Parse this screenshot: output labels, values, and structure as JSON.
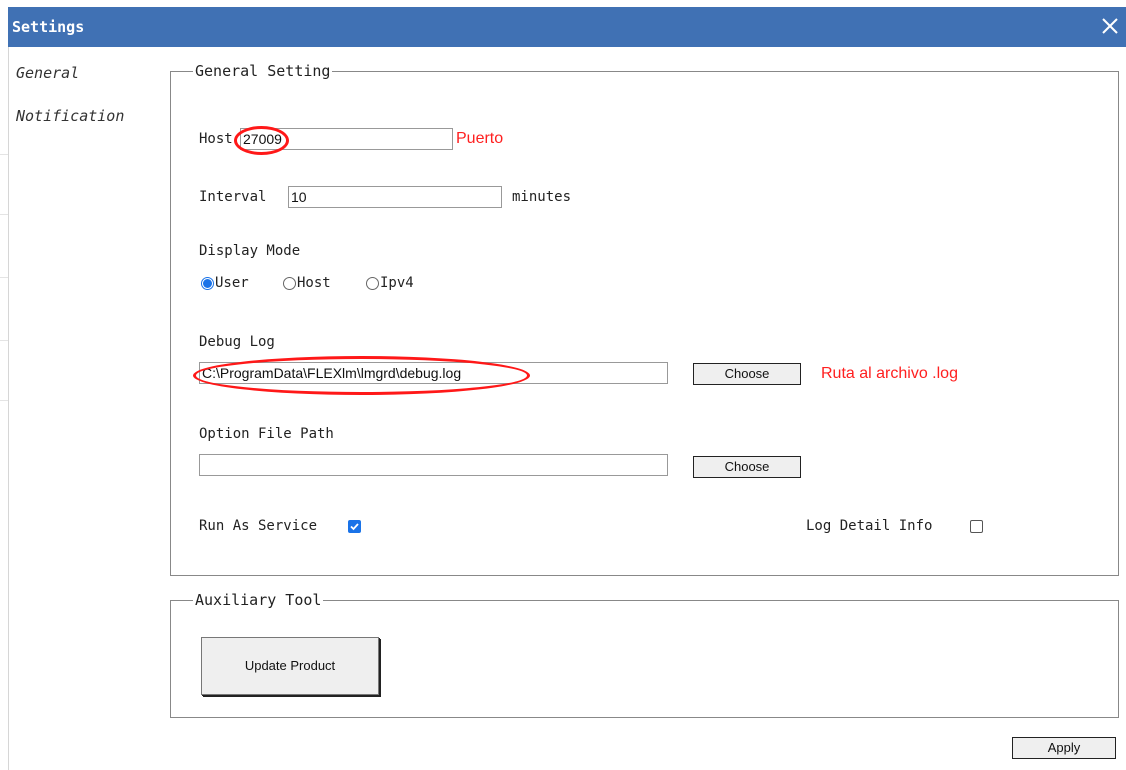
{
  "window": {
    "title": "Settings",
    "close_icon": "close-icon",
    "titlebar_color": "#4071b4"
  },
  "nav": {
    "items": [
      {
        "label": "General"
      },
      {
        "label": "Notification"
      }
    ]
  },
  "general": {
    "legend": "General Setting",
    "host": {
      "label": "Host",
      "value": "27009",
      "annotation": "Puerto"
    },
    "interval": {
      "label": "Interval",
      "value": "10",
      "unit": "minutes"
    },
    "display_mode": {
      "label": "Display Mode",
      "options": [
        {
          "label": "User",
          "checked": true
        },
        {
          "label": "Host",
          "checked": false
        },
        {
          "label": "Ipv4",
          "checked": false
        }
      ]
    },
    "debug_log": {
      "label": "Debug Log",
      "value": "C:\\ProgramData\\FLEXlm\\lmgrd\\debug.log",
      "button": "Choose",
      "annotation": "Ruta al archivo .log"
    },
    "option_file": {
      "label": "Option File Path",
      "value": "",
      "button": "Choose"
    },
    "run_as_service": {
      "label": "Run As Service",
      "checked": true
    },
    "log_detail": {
      "label": "Log Detail Info",
      "checked": false
    }
  },
  "aux": {
    "legend": "Auxiliary Tool",
    "update_button": "Update Product"
  },
  "footer": {
    "apply_button": "Apply"
  },
  "colors": {
    "accent": "#1a73e8",
    "annotation_red": "#ff2020"
  }
}
